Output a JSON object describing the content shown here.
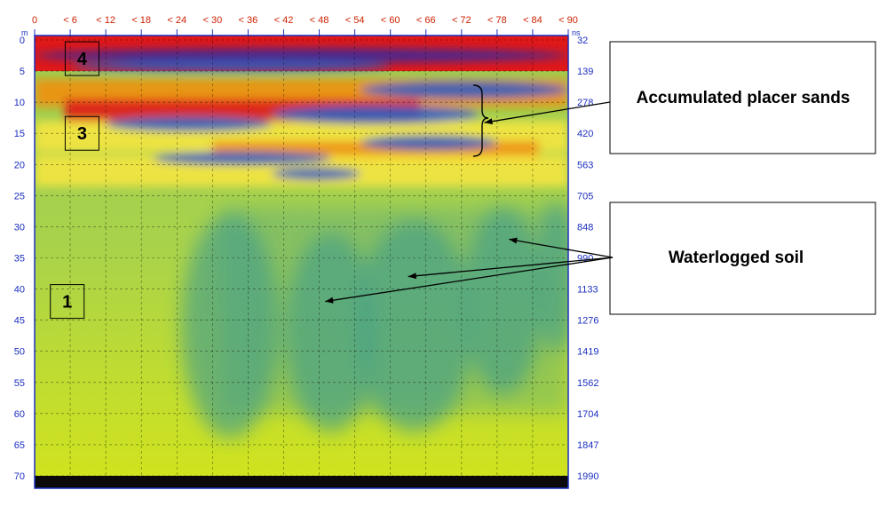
{
  "chart_data": {
    "type": "heatmap",
    "title": "",
    "xlabel": "",
    "ylabel": "",
    "x_ticks": [
      "0",
      "< 6",
      "< 12",
      "< 18",
      "< 24",
      "< 30",
      "< 36",
      "< 42",
      "< 48",
      "< 54",
      "< 60",
      "< 66",
      "< 72",
      "< 78",
      "< 84",
      "< 90"
    ],
    "x_values": [
      0,
      6,
      12,
      18,
      24,
      30,
      36,
      42,
      48,
      54,
      60,
      66,
      72,
      78,
      84,
      90
    ],
    "xlim": [
      0,
      90
    ],
    "y_unit": "m",
    "y_ticks": [
      "0",
      "5",
      "10",
      "15",
      "20",
      "25",
      "30",
      "35",
      "40",
      "45",
      "50",
      "55",
      "60",
      "65",
      "70"
    ],
    "y_values": [
      0,
      5,
      10,
      15,
      20,
      25,
      30,
      35,
      40,
      45,
      50,
      55,
      60,
      65,
      70
    ],
    "ylim": [
      0,
      70
    ],
    "y_inverted": true,
    "right_axis_unit": "ns",
    "right_ticks": [
      "32",
      "139",
      "278",
      "420",
      "563",
      "705",
      "848",
      "990",
      "1133",
      "1276",
      "1419",
      "1562",
      "1704",
      "1847",
      "1990"
    ],
    "grid": true,
    "colors": {
      "very_high": "#e01818",
      "high": "#f09010",
      "medium_high": "#f5e640",
      "low": "#2f5ec0",
      "very_low": "#3a2a9a",
      "background_soil": "#b3d64a",
      "wet_soil": "#46a08a",
      "bottom_band": "#0a0a0a"
    },
    "zones": [
      {
        "label": "4",
        "x": 8,
        "depth": 3
      },
      {
        "label": "3",
        "x": 8,
        "depth": 15
      },
      {
        "label": "1",
        "x": 5.5,
        "depth": 42
      }
    ],
    "annotations": [
      {
        "text": "Accumulated placer sands",
        "target_x": 76,
        "target_depth": 13
      },
      {
        "text": "Waterlogged soil",
        "targets": [
          [
            80,
            32
          ],
          [
            63,
            38
          ],
          [
            49,
            42
          ]
        ]
      }
    ]
  }
}
